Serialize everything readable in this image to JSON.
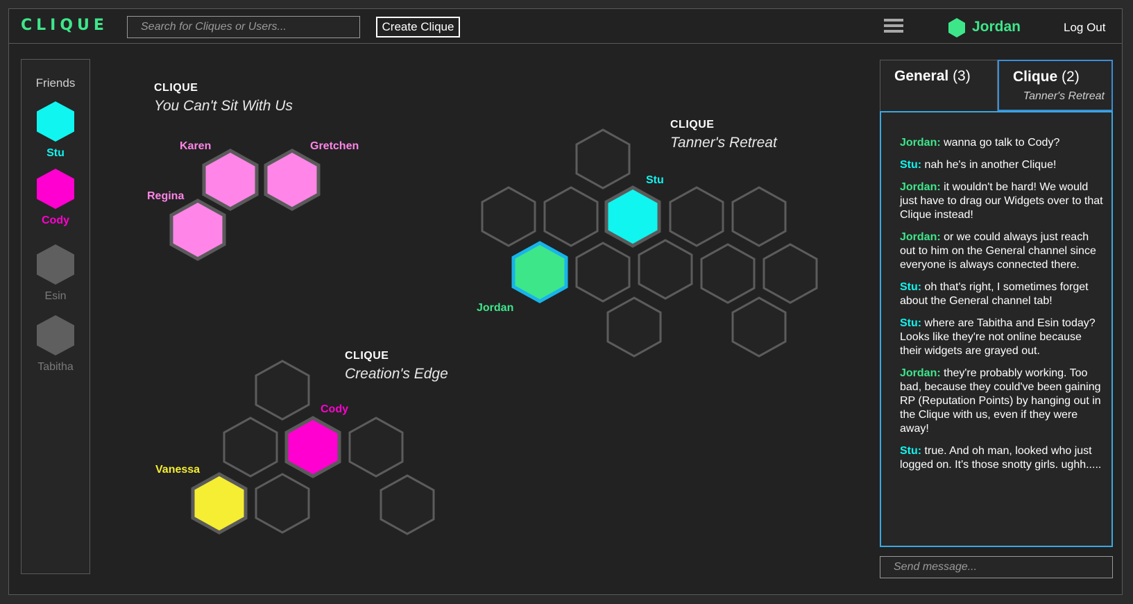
{
  "header": {
    "logo": "CLIQUE",
    "search_placeholder": "Search for Cliques or Users...",
    "create_button": "Create Clique",
    "user_name": "Jordan",
    "logout": "Log Out"
  },
  "colors": {
    "green": "#3ee68a",
    "cyan": "#10f5f0",
    "magenta": "#ff00d0",
    "pink": "#ff85e8",
    "yellow": "#f5ee32",
    "gray": "#5f5f5f",
    "chat_border": "#3aa8e0"
  },
  "friends": {
    "title": "Friends",
    "list": [
      {
        "name": "Stu",
        "status": "online",
        "color": "#10f5f0"
      },
      {
        "name": "Cody",
        "status": "online",
        "color": "#ff00d0"
      },
      {
        "name": "Esin",
        "status": "offline",
        "color": "#5f5f5f"
      },
      {
        "name": "Tabitha",
        "status": "offline",
        "color": "#5f5f5f"
      }
    ]
  },
  "cliques": [
    {
      "label": "CLIQUE",
      "name": "You Can't Sit With Us",
      "members": [
        "Karen",
        "Gretchen",
        "Regina"
      ]
    },
    {
      "label": "CLIQUE",
      "name": "Tanner's Retreat",
      "members": [
        "Stu",
        "Jordan"
      ]
    },
    {
      "label": "CLIQUE",
      "name": "Creation's Edge",
      "members": [
        "Cody",
        "Vanessa"
      ]
    }
  ],
  "chat": {
    "tabs": [
      {
        "title": "General",
        "count": "(3)",
        "subtitle": ""
      },
      {
        "title": "Clique",
        "count": "(2)",
        "subtitle": "Tanner's Retreat"
      }
    ],
    "messages": [
      {
        "who": "Jordan:",
        "text": " wanna go talk to Cody?",
        "color": "#3ee68a"
      },
      {
        "who": "Stu:",
        "text": " nah he's in another Clique!",
        "color": "#10f5f0"
      },
      {
        "who": "Jordan:",
        "text": " it wouldn't be hard!   We would just have to drag our Widgets over to that Clique instead!",
        "color": "#3ee68a"
      },
      {
        "who": "Jordan:",
        "text": " or we could always just reach out to him on the General channel since everyone is always connected there.",
        "color": "#3ee68a"
      },
      {
        "who": "Stu:",
        "text": " oh that's right, I sometimes forget about the General channel tab!",
        "color": "#10f5f0"
      },
      {
        "who": "Stu:",
        "text": " where are Tabitha and Esin today? Looks like they're not online because their widgets are grayed out.",
        "color": "#10f5f0"
      },
      {
        "who": "Jordan:",
        "text": " they're probably working.  Too bad, because they could've been gaining RP (Reputation Points) by hanging out in the Clique with us, even if they were away!",
        "color": "#3ee68a"
      },
      {
        "who": "Stu:",
        "text": " true. And oh man, looked who just logged on.  It's those snotty girls.  ughh.....",
        "color": "#10f5f0"
      }
    ],
    "send_placeholder": "Send message..."
  }
}
